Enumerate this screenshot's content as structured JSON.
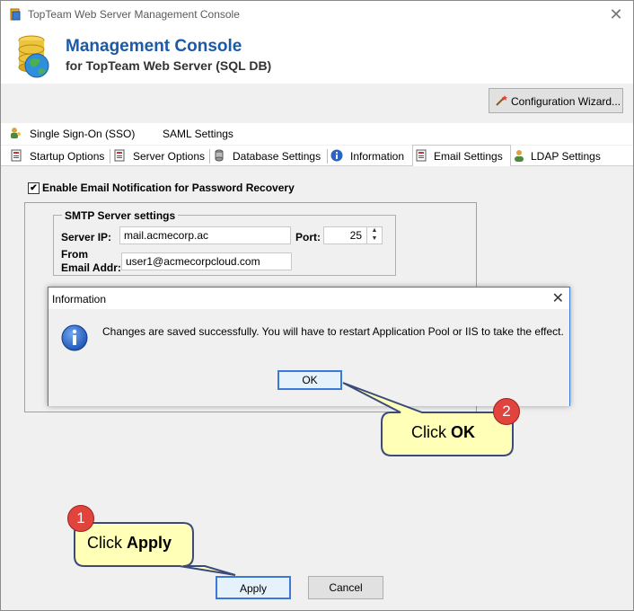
{
  "window": {
    "title": "TopTeam Web Server Management Console"
  },
  "header": {
    "title": "Management Console",
    "subtitle": "for TopTeam Web Server (SQL DB)"
  },
  "toolbar": {
    "wizard_label": "Configuration Wizard..."
  },
  "tabs_row1": [
    {
      "label": "Single Sign-On (SSO)",
      "icon": "sso-icon"
    },
    {
      "label": "SAML Settings",
      "icon": ""
    }
  ],
  "tabs_row2": [
    {
      "label": "Startup Options",
      "icon": "startup-icon"
    },
    {
      "label": "Server Options",
      "icon": "server-icon"
    },
    {
      "label": "Database Settings",
      "icon": "database-icon"
    },
    {
      "label": "Information",
      "icon": "info-icon"
    },
    {
      "label": "Email Settings",
      "icon": "email-icon",
      "active": true
    },
    {
      "label": "LDAP Settings",
      "icon": "ldap-icon"
    }
  ],
  "email_settings": {
    "enable_label": "Enable Email Notification for Password Recovery",
    "enabled": true,
    "group_title": "SMTP Server settings",
    "server_ip_label": "Server IP:",
    "server_ip_value": "mail.acmecorp.ac",
    "port_label": "Port:",
    "port_value": "25",
    "from_label_line1": "From",
    "from_label_line2": "Email Addr:",
    "from_value": "user1@acmecorpcloud.com"
  },
  "dialog": {
    "title": "Information",
    "message": "Changes are saved successfully. You will have to restart Application Pool or IIS to take the effect.",
    "ok_label": "OK"
  },
  "footer": {
    "apply_label": "Apply",
    "cancel_label": "Cancel"
  },
  "callouts": {
    "step1": {
      "number": "1",
      "prefix": "Click ",
      "bold": "Apply"
    },
    "step2": {
      "number": "2",
      "prefix": "Click ",
      "bold": "OK"
    }
  },
  "colors": {
    "accent": "#3c78d8",
    "title_blue": "#1a5aa8",
    "callout_fill": "#ffffb8",
    "callout_border": "#3a4a7a",
    "badge_red": "#e0443c"
  }
}
